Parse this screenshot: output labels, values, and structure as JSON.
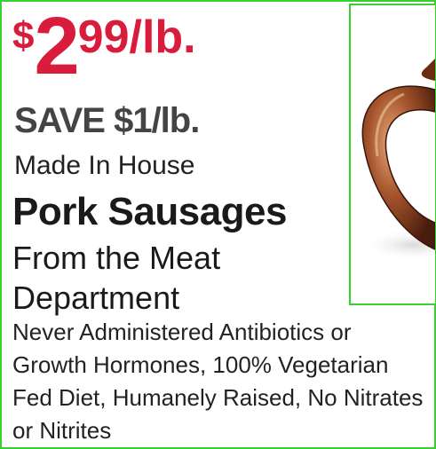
{
  "price": {
    "currency": "$",
    "dollars": "2",
    "cents_unit": "99/lb.",
    "color": "#d91b3c"
  },
  "savings": "SAVE $1/lb.",
  "tagline": "Made In House",
  "product_name": "Pork Sausages",
  "department": "From the Meat Department",
  "description": "Never Administered Antibiotics or Growth Hormones, 100% Vegetarian Fed Diet, Humanely Raised, No Nitrates or Nitrites",
  "accent_color": "#39d12f"
}
